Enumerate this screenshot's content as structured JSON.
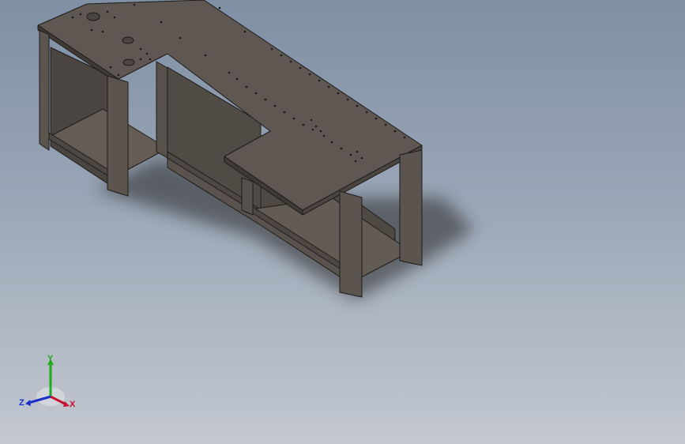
{
  "viewport": {
    "background_top": "#7f8fa4",
    "background_bottom": "#c3c8d0"
  },
  "model": {
    "part_color": "#5d5650",
    "edge_color": "#1e1c1a",
    "shadow_color": "#262626"
  },
  "triad": {
    "x_label": "X",
    "y_label": "Y",
    "z_label": "Z",
    "x_color": "#c8102e",
    "y_color": "#1faa1f",
    "z_color": "#1a2fc9"
  }
}
